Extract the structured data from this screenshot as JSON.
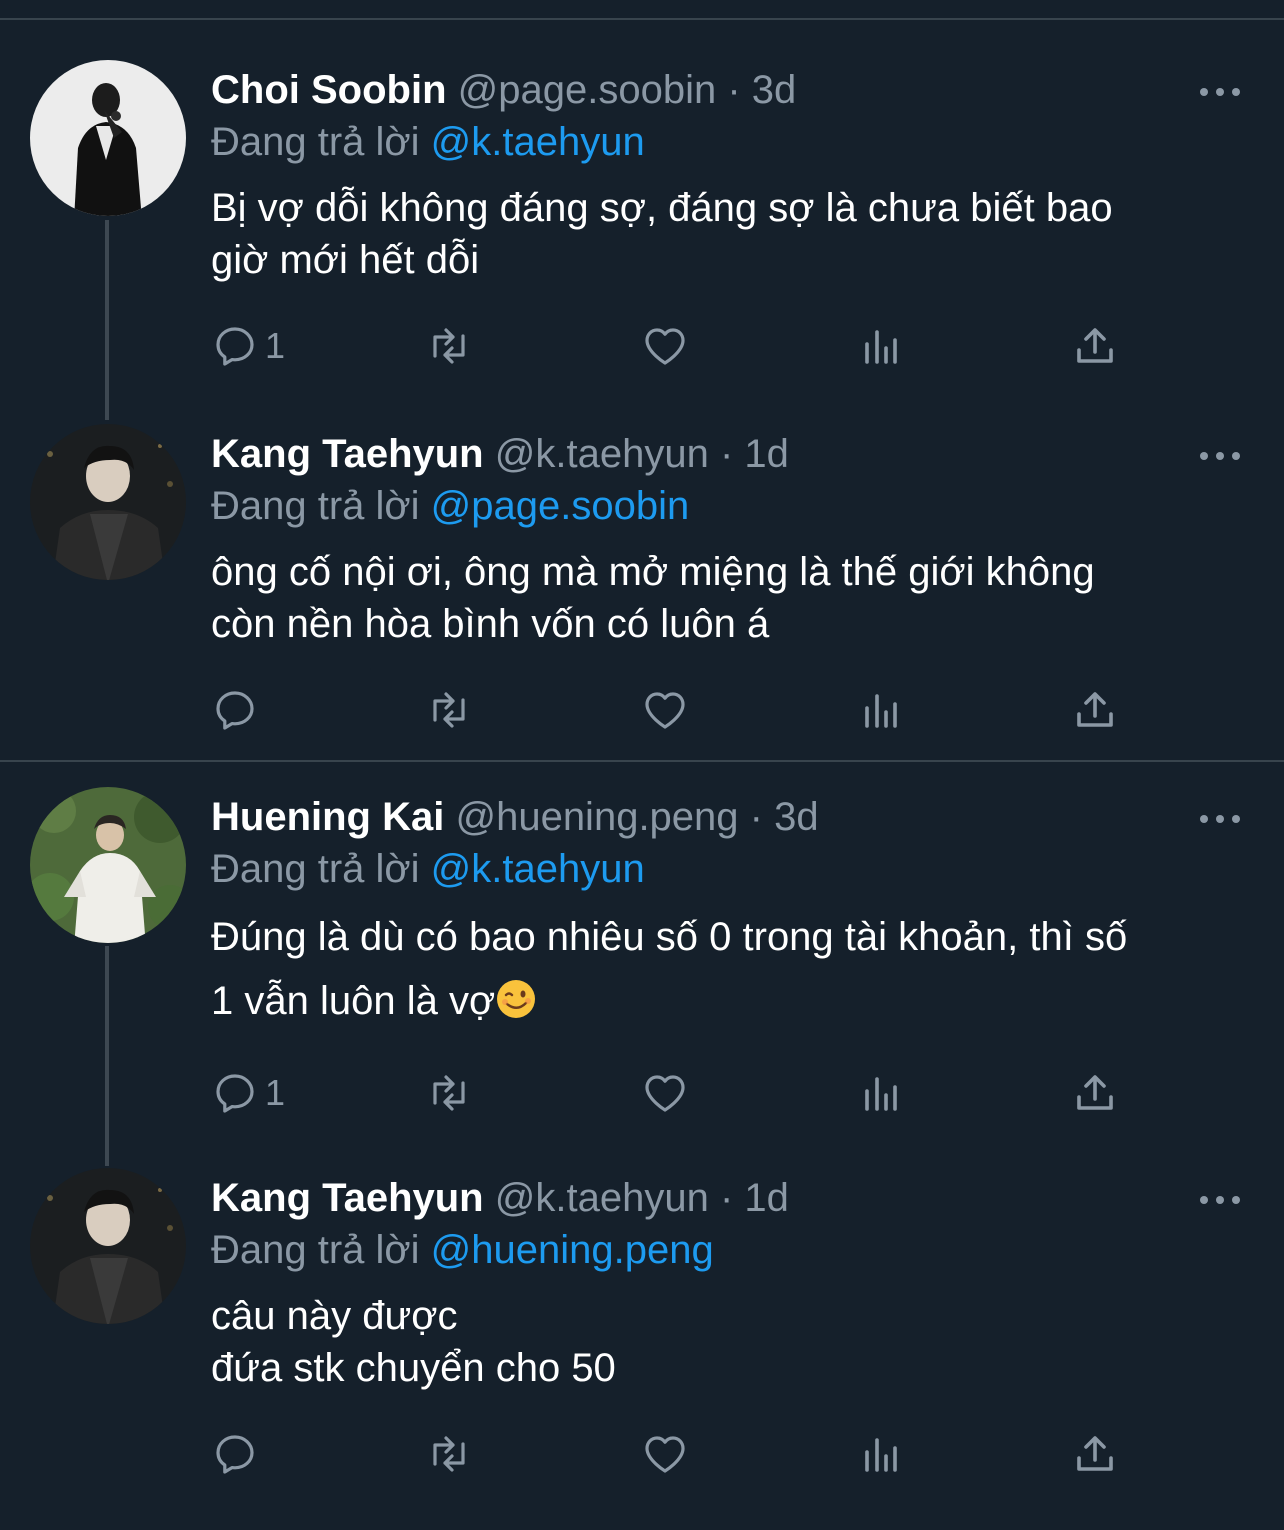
{
  "replies": [
    {
      "name": "Choi Soobin",
      "handle": "@page.soobin",
      "separator": "·",
      "time": "3d",
      "replying_label": "Đang trả lời",
      "replying_to": "@k.taehyun",
      "text_lines": [
        "Bị vợ dỗi không đáng sợ, đáng sợ là chưa biết bao",
        "giờ mới hết dỗi"
      ],
      "reply_count": "1"
    },
    {
      "name": "Kang Taehyun",
      "handle": "@k.taehyun",
      "separator": "·",
      "time": "1d",
      "replying_label": "Đang trả lời",
      "replying_to": "@page.soobin",
      "text_lines": [
        "ông cố nội ơi, ông mà mở miệng là thế giới không",
        "còn nền hòa bình vốn có luôn á"
      ],
      "reply_count": ""
    },
    {
      "name": "Huening Kai",
      "handle": "@huening.peng",
      "separator": "·",
      "time": "3d",
      "replying_label": "Đang trả lời",
      "replying_to": "@k.taehyun",
      "text_lines": [
        "Đúng là dù có bao nhiêu số 0 trong tài khoản, thì số",
        "1 vẫn luôn là vợ"
      ],
      "emoji": "winking-face",
      "reply_count": "1"
    },
    {
      "name": "Kang Taehyun",
      "handle": "@k.taehyun",
      "separator": "·",
      "time": "1d",
      "replying_label": "Đang trả lời",
      "replying_to": "@huening.peng",
      "text_lines": [
        "câu này được",
        "đứa stk chuyển cho 50"
      ],
      "reply_count": ""
    }
  ],
  "icons": {
    "reply": "reply-icon",
    "retweet": "retweet-icon",
    "like": "like-icon",
    "views": "views-icon",
    "share": "share-icon",
    "more": "more-icon"
  },
  "colors": {
    "background": "#15202b",
    "accent": "#1d9bf0",
    "secondary_text": "#8b98a5",
    "divider": "#38444d"
  }
}
